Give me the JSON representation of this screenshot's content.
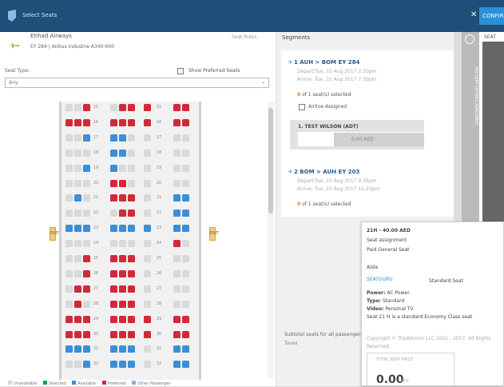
{
  "window": {
    "title": "Select Seats",
    "close_glyph": "✕",
    "confirm_label": "CONFIRM"
  },
  "flight": {
    "airline": "Etihad Airways",
    "info": "EY 284 | Airbus Industrie A340-600",
    "seat_rules": "Seat Rules"
  },
  "filters": {
    "seat_type_label": "Seat Type:",
    "seat_type_value": "Any",
    "show_preferred_label": "Show Preferred Seats"
  },
  "seatmap": {
    "rows": [
      "15",
      "16",
      "17",
      "18",
      "19",
      "20",
      "21",
      "22",
      "23",
      "24",
      "25",
      "26",
      "27",
      "28",
      "29",
      "30",
      "31",
      "32"
    ],
    "exit_row": "23",
    "exit_label": "EXIT",
    "seat_status": [
      [
        "occ",
        "occ",
        "pref",
        "occ",
        "pref",
        "pref",
        "pref",
        "pref",
        "pref"
      ],
      [
        "pref",
        "pref",
        "pref",
        "pref",
        "pref",
        "pref",
        "pref",
        "pref",
        "pref"
      ],
      [
        "occ",
        "occ",
        "avail",
        "avail",
        "avail",
        "occ",
        "occ",
        "occ",
        "occ"
      ],
      [
        "occ",
        "occ",
        "occ",
        "avail",
        "avail",
        "occ",
        "occ",
        "occ",
        "occ"
      ],
      [
        "occ",
        "occ",
        "avail",
        "avail",
        "occ",
        "occ",
        "occ",
        "occ",
        "occ"
      ],
      [
        "occ",
        "occ",
        "occ",
        "pref",
        "pref",
        "occ",
        "occ",
        "occ",
        "occ"
      ],
      [
        "occ",
        "avail",
        "occ",
        "pref",
        "pref",
        "pref",
        "occ",
        "avail",
        "avail"
      ],
      [
        "occ",
        "occ",
        "occ",
        "occ",
        "pref",
        "pref",
        "occ",
        "avail",
        "avail"
      ],
      [
        "avail",
        "avail",
        "avail",
        "avail",
        "avail",
        "avail",
        "avail",
        "avail",
        "avail"
      ],
      [
        "occ",
        "occ",
        "occ",
        "occ",
        "occ",
        "occ",
        "occ",
        "pref",
        "occ"
      ],
      [
        "occ",
        "occ",
        "pref",
        "pref",
        "pref",
        "pref",
        "occ",
        "occ",
        "occ"
      ],
      [
        "occ",
        "occ",
        "pref",
        "pref",
        "pref",
        "pref",
        "occ",
        "occ",
        "occ"
      ],
      [
        "occ",
        "pref",
        "pref",
        "pref",
        "pref",
        "pref",
        "occ",
        "occ",
        "occ"
      ],
      [
        "occ",
        "pref",
        "occ",
        "pref",
        "pref",
        "pref",
        "occ",
        "occ",
        "occ"
      ],
      [
        "pref",
        "pref",
        "pref",
        "pref",
        "pref",
        "pref",
        "pref",
        "pref",
        "pref"
      ],
      [
        "pref",
        "pref",
        "pref",
        "pref",
        "pref",
        "pref",
        "pref",
        "pref",
        "pref"
      ],
      [
        "avail",
        "avail",
        "avail",
        "avail",
        "avail",
        "avail",
        "occ",
        "avail",
        "avail"
      ],
      [
        "occ",
        "occ",
        "avail",
        "avail",
        "avail",
        "avail",
        "occ",
        "avail",
        "avail"
      ]
    ]
  },
  "legend": {
    "items": [
      "Unavailable",
      "Selected",
      "Available",
      "Preferred",
      "Other Passenger"
    ]
  },
  "colors": {
    "available": "#3b8fd6",
    "preferred": "#d2293a",
    "occupied": "#d9d9d9",
    "selected": "#1ea24d",
    "header": "#1f4e79",
    "exit": "#f5c886"
  },
  "segments": {
    "title": "Segments",
    "items": [
      {
        "route": "1 AUH > BOM EY 284",
        "depart_label": "Depart:",
        "depart": "Tue, 15 Aug 2017 2:20pm",
        "arrive_label": "Arrive:",
        "arrive": "Tue, 15 Aug 2017 7:30pm",
        "count": "0",
        "selected_text": " of 1 seat(s) selected"
      },
      {
        "route": "2 BOM > AUH EY 203",
        "depart_label": "Depart:",
        "depart": "Tue, 22 Aug 2017 9:35pm",
        "arrive_label": "Arrive:",
        "arrive": "Tue, 22 Aug 2017 11:25pm",
        "count": "0",
        "selected_text": " of 1 seat(s) selected"
      }
    ],
    "airline_assigned": "Airline Assigned",
    "passenger": {
      "name": "1. TEST WILSON (ADT)",
      "price": "0.00 AED"
    },
    "subtotal_label": "Subtotal seats for all passengers",
    "taxes_label": "Taxes"
  },
  "strip": {
    "text": "NO SEAT DETAILS AVAILABLE"
  },
  "right": {
    "label": "SEAT"
  },
  "tooltip": {
    "header": "21H - 40.00 AED",
    "line1": "Seat assignment",
    "line2": "Paid General Seat",
    "line3": "Aisle",
    "seatguru": "SEATGURU",
    "seat_class": "Standard Seat",
    "power_label": "Power:",
    "power": "AC Power",
    "type_label": "Type:",
    "type": "Standard",
    "video_label": "Video:",
    "video": "Personal TV",
    "desc": "Seat 21 H is a standard Economy Class seat",
    "copyright": "Copyright © TripAdvisor LLC 2001 - 2017. All Rights",
    "reserved": "Reserved."
  },
  "total": {
    "label": "TOTAL SEAT PRICE",
    "value": "0.00",
    "currency": "AED"
  }
}
